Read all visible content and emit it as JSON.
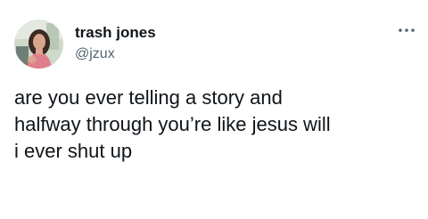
{
  "tweet": {
    "author": {
      "display_name": "trash jones",
      "handle": "@jzux",
      "avatar_icon": "profile-photo"
    },
    "more_icon": "ellipsis-horizontal-icon",
    "text": "are you ever telling a story and\nhalfway through you’re like jesus will\ni ever shut up"
  },
  "colors": {
    "text_primary": "#0f1419",
    "text_secondary": "#536471",
    "background": "#ffffff"
  }
}
